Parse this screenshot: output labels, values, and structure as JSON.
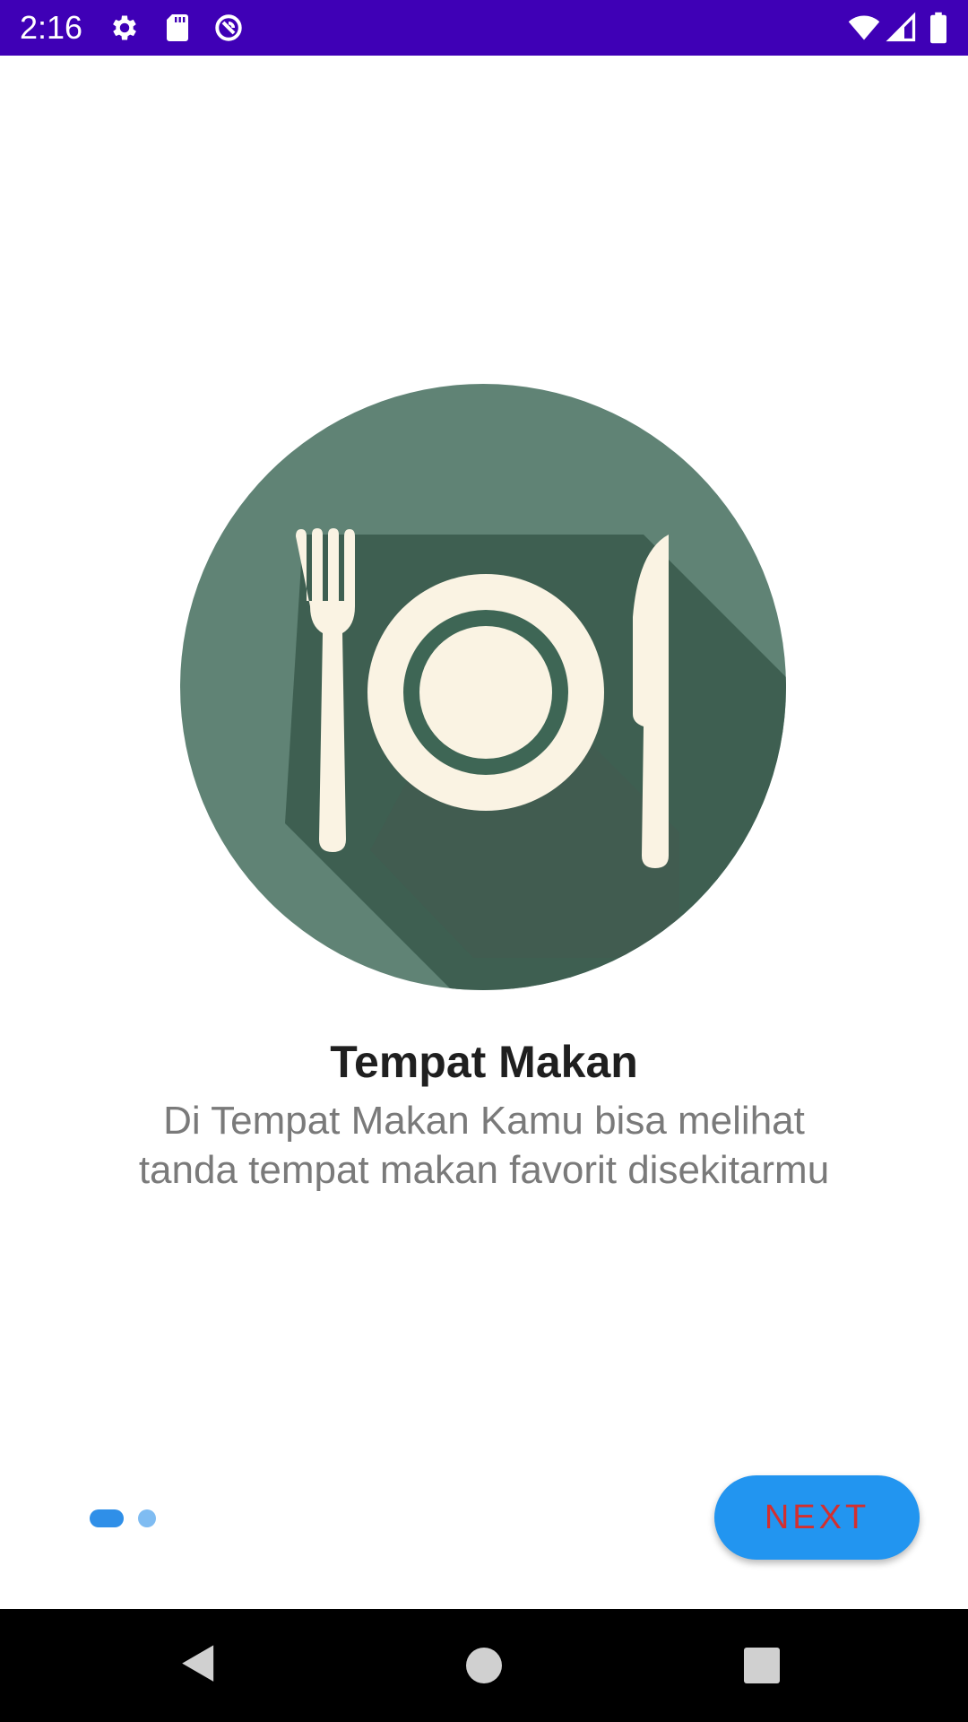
{
  "status_bar": {
    "time": "2:16",
    "background_color": "#3f00b6",
    "left_icons": [
      "gear-icon",
      "sd-card-icon",
      "data-saver-icon"
    ],
    "right_icons": [
      "wifi-icon",
      "signal-icon",
      "battery-icon"
    ]
  },
  "onboarding": {
    "illustration_icon": "plate-fork-knife-icon",
    "title": "Tempat Makan",
    "description": "Di Tempat Makan Kamu bisa melihat tanda tempat makan favorit disekitarmu"
  },
  "page_indicator": {
    "current_page": 1,
    "total_pages": 2
  },
  "next_button": {
    "label": "NEXT",
    "background_color": "#2295f0",
    "text_color": "#d32f2f"
  },
  "nav_bar": {
    "buttons": [
      "back-icon",
      "home-icon",
      "recents-icon"
    ]
  }
}
